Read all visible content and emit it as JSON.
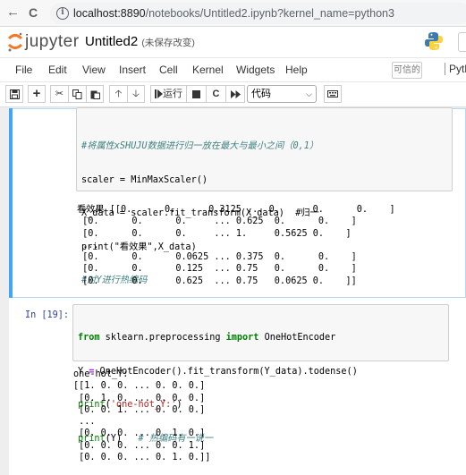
{
  "browser": {
    "back": "←",
    "forward": "→",
    "reload": "C",
    "url_host": "localhost:8890",
    "url_path": "/notebooks/Untitled2.ipynb?kernel_name=python3"
  },
  "header": {
    "logo_text": "jupyter",
    "title": "Untitled2",
    "status": "(未保存改变)"
  },
  "menu": {
    "items": [
      "File",
      "Edit",
      "View",
      "Insert",
      "Cell",
      "Kernel",
      "Widgets",
      "Help"
    ],
    "trusted": "可信的",
    "kernel": "Pyth"
  },
  "toolbar": {
    "run_label": "运行",
    "cell_type": "代码"
  },
  "cells": [
    {
      "prompt": "",
      "code_lines": [
        "#将属性xSHUJU数据进行归一放在最大与最小之间（0,1）",
        "scaler = MinMaxScaler()",
        "X_data = scaler.fit_transform(X_data)  #归一",
        "print(\"看效果\",X_data)",
        "#对Y进行热编码"
      ],
      "output": "看效果 [[0.      0.      0.3125 ... 0.      0.      0.    ]\n [0.      0.      0.     ... 0.625  0.      0.    ]\n [0.      0.      0.     ... 1.     0.5625 0.    ]\n ...\n [0.      0.      0.0625 ... 0.375  0.      0.    ]\n [0.      0.      0.125  ... 0.75   0.      0.    ]\n [0.      0.      0.625  ... 0.75   0.0625 0.    ]]"
    },
    {
      "prompt": "In  [19]:",
      "code_lines": [
        "from sklearn.preprocessing import OneHotEncoder",
        "Y = OneHotEncoder().fit_transform(Y_data).todense()",
        "print('one-hot_Y:')",
        "print(Y)   # 热编码有一说一"
      ],
      "output": "one-hot_Y:\n[[1. 0. 0. ... 0. 0. 0.]\n [0. 1. 0. ... 0. 0. 0.]\n [0. 0. 1. ... 0. 0. 0.]\n ...\n [0. 0. 0. ... 0. 1. 0.]\n [0. 0. 0. ... 0. 0. 1.]\n [0. 0. 0. ... 0. 1. 0.]]"
    }
  ]
}
